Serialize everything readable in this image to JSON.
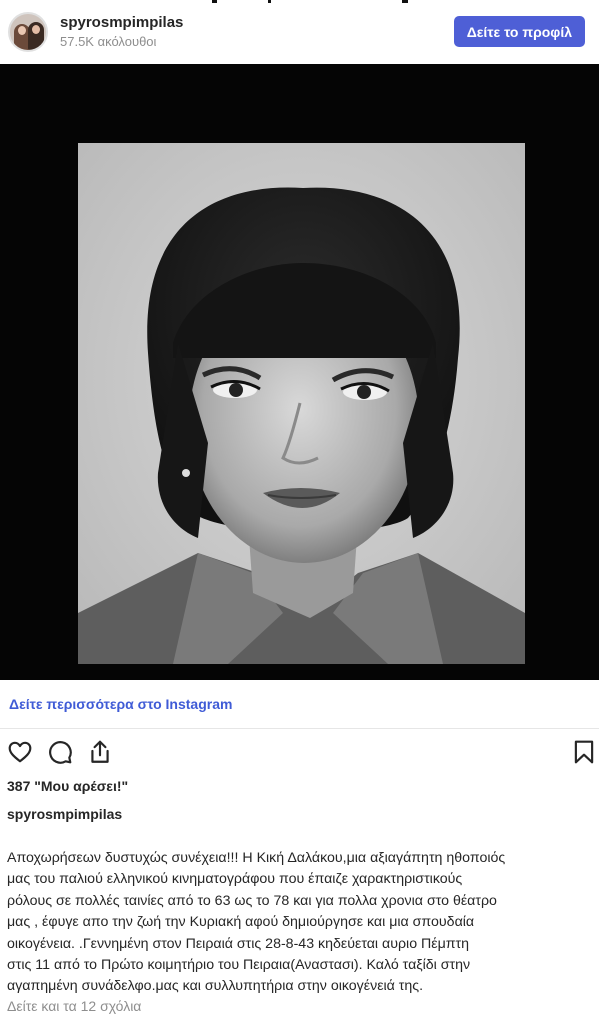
{
  "header": {
    "username": "spyrosmpimpilas",
    "followers": "57.5K ακόλουθοι",
    "profile_button": "Δείτε το προφίλ"
  },
  "post": {
    "see_more_link": "Δείτε περισσότερα στο Instagram",
    "likes": "387 \"Μου αρέσει!\"",
    "caption_username": "spyrosmpimpilas",
    "caption_lines": [
      "Αποχωρήσεων δυστυχώς συνέχεια!!! Η Κική Δαλάκου,μια αξιαγάπητη ηθοποιός",
      "μας του παλιού ελληνικού κινηματογράφου που έπαιζε χαρακτηριστικούς",
      "ρόλους σε πολλές ταινίες από το 63 ως το 78 και για πολλα χρονια στο θέατρο",
      "μας , έφυγε απο την ζωή την Κυριακή αφού δημιούργησε και μια σπουδαία",
      "οικογένεια. .Γεννημένη στον Πειραιά στις 28-8-43 κηδεύεται αυριο Πέμπτη",
      "στις 11 από το Πρώτο κοιμητήριο του Πειραια(Αναστασι). Καλό ταξίδι στην",
      "αγαπημένη συνάδελφο.μας και συλλυπητήρια στην οικογένειά της."
    ],
    "comments_link": "Δείτε και τα 12 σχόλια"
  },
  "icons": {
    "like": "heart-icon",
    "comment": "comment-icon",
    "share": "share-icon",
    "save": "bookmark-icon"
  },
  "colors": {
    "accent": "#4e5fd6",
    "link": "#3f5bd6",
    "muted": "#8e8e8e",
    "text": "#262626"
  }
}
